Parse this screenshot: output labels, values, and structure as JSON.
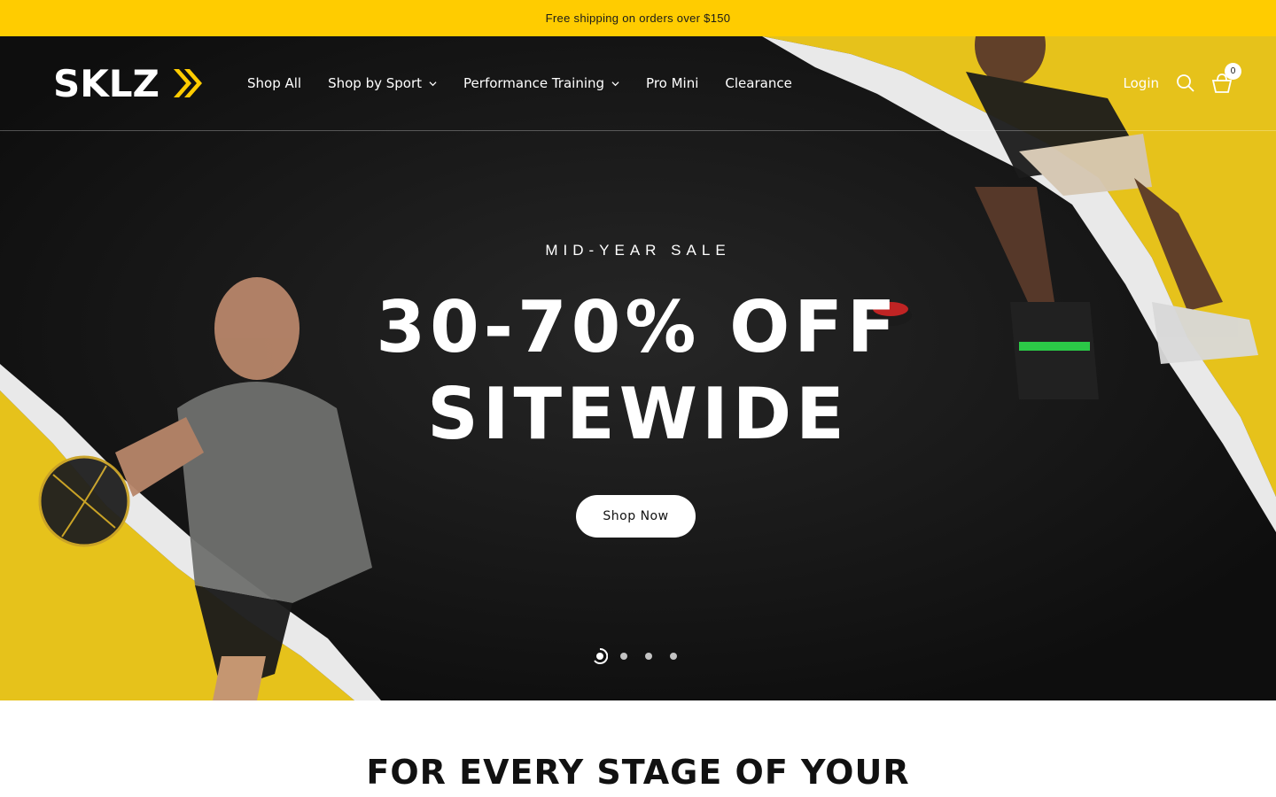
{
  "announcement": {
    "text": "Free shipping on orders over $150"
  },
  "header": {
    "logo_text": "SKLZ",
    "nav": [
      {
        "label": "Shop All",
        "has_dropdown": false
      },
      {
        "label": "Shop by Sport",
        "has_dropdown": true
      },
      {
        "label": "Performance Training",
        "has_dropdown": true
      },
      {
        "label": "Pro Mini",
        "has_dropdown": false
      },
      {
        "label": "Clearance",
        "has_dropdown": false
      }
    ],
    "login_label": "Login",
    "search_icon": "search-icon",
    "cart_icon": "basket-icon",
    "cart_count": "0"
  },
  "hero": {
    "eyebrow": "MID-YEAR SALE",
    "headline_line1": "30-70% OFF",
    "headline_line2": "SITEWIDE",
    "cta_label": "Shop Now",
    "slides_total": 4,
    "active_slide": 1
  },
  "section": {
    "title": "FOR EVERY STAGE OF YOUR"
  },
  "colors": {
    "accent": "#ffcc00",
    "dark": "#151515",
    "white": "#ffffff"
  }
}
